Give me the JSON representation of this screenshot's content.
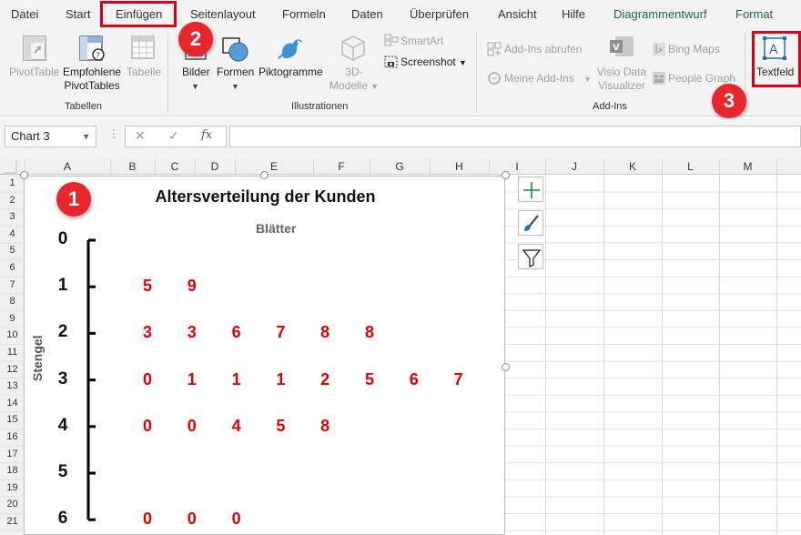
{
  "tabs": [
    {
      "label": "Datei"
    },
    {
      "label": "Start"
    },
    {
      "label": "Einfügen"
    },
    {
      "label": "Seitenlayout"
    },
    {
      "label": "Formeln"
    },
    {
      "label": "Daten"
    },
    {
      "label": "Überprüfen"
    },
    {
      "label": "Ansicht"
    },
    {
      "label": "Hilfe"
    },
    {
      "label": "Diagrammentwurf"
    },
    {
      "label": "Format"
    }
  ],
  "ribbon": {
    "tabellen": {
      "pivottable": "PivotTable",
      "empfohlene_1": "Empfohlene",
      "empfohlene_2": "PivotTables",
      "tabelle": "Tabelle",
      "group": "Tabellen"
    },
    "illustrationen": {
      "bilder": "Bilder",
      "formen": "Formen",
      "piktogramme": "Piktogramme",
      "modelle_1": "3D-",
      "modelle_2": "Modelle",
      "smartart": "SmartArt",
      "screenshot": "Screenshot",
      "group": "Illustrationen"
    },
    "addins": {
      "abrufen": "Add-Ins abrufen",
      "meine": "Meine Add-Ins",
      "visio_1": "Visio Data",
      "visio_2": "Visualizer",
      "bing": "Bing Maps",
      "people": "People Graph",
      "group": "Add-Ins"
    },
    "text": {
      "textfeld": "Textfeld"
    }
  },
  "callouts": {
    "one": "1",
    "two": "2",
    "three": "3"
  },
  "formula_bar": {
    "name_box": "Chart 3",
    "fx_label": "fx",
    "value": ""
  },
  "grid": {
    "columns": [
      "A",
      "B",
      "C",
      "D",
      "E",
      "F",
      "G",
      "H",
      "I",
      "J",
      "K",
      "L",
      "M"
    ],
    "rows": [
      "1",
      "2",
      "3",
      "4",
      "5",
      "6",
      "7",
      "8",
      "9",
      "10",
      "11",
      "12",
      "13",
      "14",
      "15",
      "16",
      "17",
      "18",
      "19",
      "20",
      "21"
    ]
  },
  "chart_data": {
    "type": "table",
    "title": "Altersverteilung der Kunden",
    "subtitle": "Blätter",
    "ylabel": "Stengel",
    "stems": [
      "0",
      "1",
      "2",
      "3",
      "4",
      "5",
      "6"
    ],
    "leaves": [
      [],
      [
        "5",
        "9"
      ],
      [
        "3",
        "3",
        "6",
        "7",
        "8",
        "8"
      ],
      [
        "0",
        "1",
        "1",
        "1",
        "2",
        "5",
        "6",
        "7"
      ],
      [
        "0",
        "0",
        "4",
        "5",
        "8"
      ],
      [],
      [
        "0",
        "0",
        "0"
      ]
    ]
  },
  "colors": {
    "highlight_box": "#d9001b",
    "callout": "#e8262c",
    "leaf_text": "#e00000",
    "context_tab": "#1e6b3a"
  },
  "icons": [
    "pivottable-icon",
    "recommended-pivot-icon",
    "table-icon",
    "pictures-icon",
    "shapes-icon",
    "icons-icon",
    "3d-models-icon",
    "smartart-icon",
    "screenshot-icon",
    "store-icon",
    "my-addins-icon",
    "visio-icon",
    "bing-maps-icon",
    "people-graph-icon",
    "textbox-icon",
    "plus-icon",
    "brush-icon",
    "filter-icon"
  ]
}
